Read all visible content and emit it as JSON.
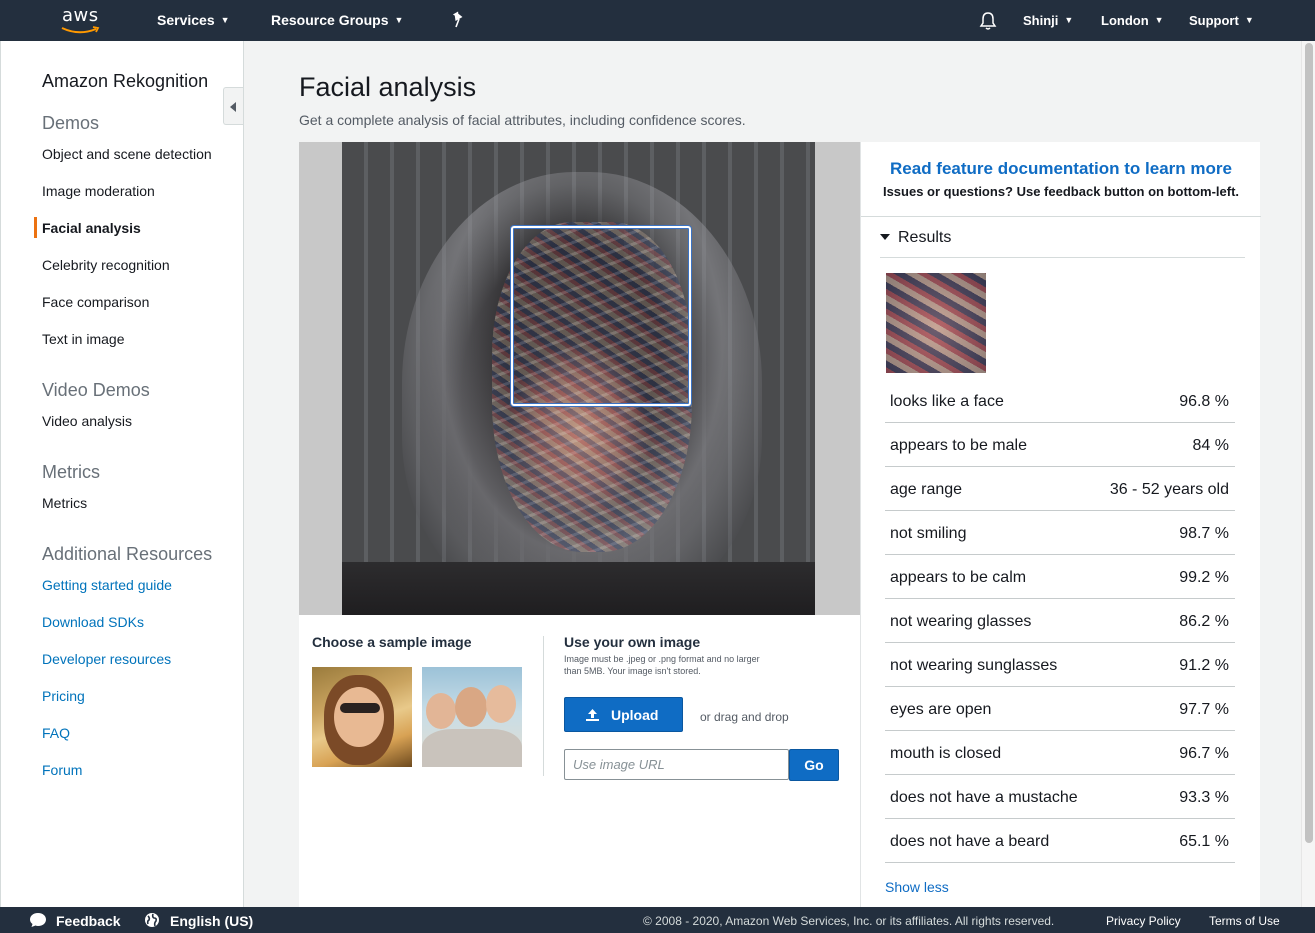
{
  "topnav": {
    "logo_text": "aws",
    "services": "Services",
    "resource_groups": "Resource Groups",
    "user": "Shinji",
    "region": "London",
    "support": "Support"
  },
  "sidebar": {
    "title": "Amazon Rekognition",
    "sections": [
      {
        "heading": "Demos",
        "items": [
          "Object and scene detection",
          "Image moderation",
          "Facial analysis",
          "Celebrity recognition",
          "Face comparison",
          "Text in image"
        ]
      },
      {
        "heading": "Video Demos",
        "items": [
          "Video analysis"
        ]
      },
      {
        "heading": "Metrics",
        "items": [
          "Metrics"
        ]
      },
      {
        "heading": "Additional Resources",
        "items": [
          "Getting started guide",
          "Download SDKs",
          "Developer resources",
          "Pricing",
          "FAQ",
          "Forum"
        ]
      }
    ],
    "active_item": "Facial analysis"
  },
  "main": {
    "title": "Facial analysis",
    "subtitle": "Get a complete analysis of facial attributes, including confidence scores.",
    "choose_sample": "Choose a sample image",
    "own_image": {
      "label": "Use your own image",
      "note": "Image must be .jpeg or .png format and no larger than 5MB. Your image isn't stored.",
      "upload": "Upload",
      "drag": "or drag and drop",
      "url_placeholder": "Use image URL",
      "go": "Go"
    }
  },
  "results": {
    "doc_link": "Read feature documentation to learn more",
    "doc_note": "Issues or questions? Use feedback button on bottom-left.",
    "title": "Results",
    "rows": [
      {
        "label": "looks like a face",
        "value": "96.8 %"
      },
      {
        "label": "appears to be male",
        "value": "84 %"
      },
      {
        "label": "age range",
        "value": "36 - 52 years old"
      },
      {
        "label": "not smiling",
        "value": "98.7 %"
      },
      {
        "label": "appears to be calm",
        "value": "99.2 %"
      },
      {
        "label": "not wearing glasses",
        "value": "86.2 %"
      },
      {
        "label": "not wearing sunglasses",
        "value": "91.2 %"
      },
      {
        "label": "eyes are open",
        "value": "97.7 %"
      },
      {
        "label": "mouth is closed",
        "value": "96.7 %"
      },
      {
        "label": "does not have a mustache",
        "value": "93.3 %"
      },
      {
        "label": "does not have a beard",
        "value": "65.1 %"
      }
    ],
    "show_less": "Show less"
  },
  "footer": {
    "feedback": "Feedback",
    "language": "English (US)",
    "copyright": "© 2008 - 2020, Amazon Web Services, Inc. or its affiliates. All rights reserved.",
    "privacy": "Privacy Policy",
    "terms": "Terms of Use"
  },
  "colors": {
    "nav_bg": "#232f3e",
    "accent_orange": "#ec7211",
    "link_blue": "#0073bb",
    "button_blue": "#0f6cc4"
  }
}
